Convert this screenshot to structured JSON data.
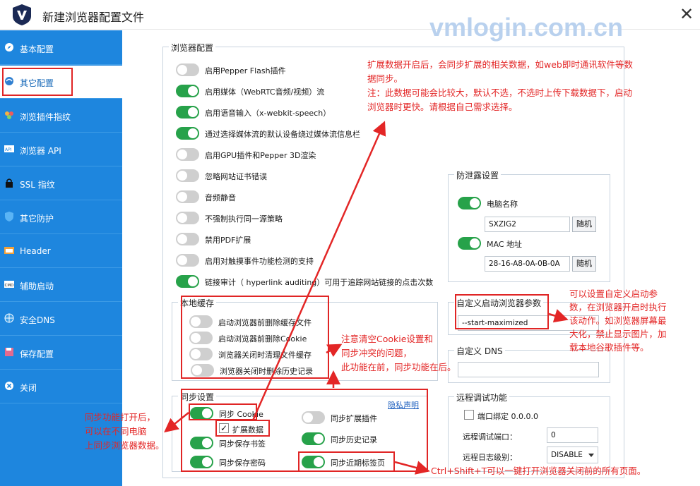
{
  "window": {
    "title": "新建浏览器配置文件",
    "close_label": "✕"
  },
  "watermark": "vmlogin.com.cn",
  "sidebar": {
    "items": [
      {
        "label": "基本配置",
        "icon": "compass-icon"
      },
      {
        "label": "其它配置",
        "icon": "browser-globe-icon",
        "active": true
      },
      {
        "label": "浏览插件指纹",
        "icon": "puzzle-icon"
      },
      {
        "label": "浏览器 API",
        "icon": "api-icon"
      },
      {
        "label": "SSL 指纹",
        "icon": "lock-icon"
      },
      {
        "label": "其它防护",
        "icon": "shield-icon"
      },
      {
        "label": "Header",
        "icon": "header-icon"
      },
      {
        "label": "辅助启动",
        "icon": "cmd-icon"
      },
      {
        "label": "安全DNS",
        "icon": "dns-globe-icon"
      },
      {
        "label": "保存配置",
        "icon": "floppy-icon"
      },
      {
        "label": "关闭",
        "icon": "close-circle-icon"
      }
    ]
  },
  "browser_config": {
    "title": "浏览器配置",
    "toggles": [
      {
        "label": "启用Pepper Flash插件",
        "on": false
      },
      {
        "label": "启用媒体（WebRTC音频/视频）流",
        "on": true
      },
      {
        "label": "启用语音输入（x-webkit-speech）",
        "on": true
      },
      {
        "label": "通过选择媒体流的默认设备绕过媒体流信息栏",
        "on": true
      },
      {
        "label": "启用GPU插件和Pepper 3D渲染",
        "on": false
      },
      {
        "label": "忽略网站证书错误",
        "on": false
      },
      {
        "label": "音频静音",
        "on": false
      },
      {
        "label": "不强制执行同一源策略",
        "on": false
      },
      {
        "label": "禁用PDF扩展",
        "on": false
      },
      {
        "label": "启用对触摸事件功能检测的支持",
        "on": false
      },
      {
        "label": "链接审计（ hyperlink auditing）可用于追踪网站链接的点击次数",
        "on": true
      }
    ]
  },
  "local_cache": {
    "title": "本地缓存",
    "toggles": [
      {
        "label": "启动浏览器前删除缓存文件",
        "on": false
      },
      {
        "label": "启动浏览器前删除Cookie",
        "on": false
      },
      {
        "label": "浏览器关闭时清理文件缓存",
        "on": false
      },
      {
        "label": "浏览器关闭时删除历史记录",
        "on": false
      }
    ]
  },
  "sync": {
    "title": "同步设置",
    "privacy_link": "隐私声明",
    "cookie": {
      "label": "同步 Cookie",
      "on": true
    },
    "extension_data": {
      "label": "扩展数据",
      "checked": true,
      "check_mark": "✓"
    },
    "bookmarks": {
      "label": "同步保存书签",
      "on": true
    },
    "passwords": {
      "label": "同步保存密码",
      "on": true
    },
    "extensions": {
      "label": "同步扩展插件",
      "on": false
    },
    "history": {
      "label": "同步历史记录",
      "on": true
    },
    "recent_tabs": {
      "label": "同步近期标签页",
      "on": true
    }
  },
  "anti_leak": {
    "title": "防泄露设置",
    "computer_name": {
      "label": "电脑名称",
      "on": true,
      "value": "SXZIG2",
      "random_label": "随机"
    },
    "mac": {
      "label": "MAC 地址",
      "on": true,
      "value": "28-16-A8-0A-0B-0A",
      "random_label": "随机"
    }
  },
  "custom_params": {
    "title": "自定义启动浏览器参数",
    "value": "--start-maximized"
  },
  "custom_dns": {
    "title": "自定义 DNS",
    "value": ""
  },
  "remote_debug": {
    "title": "远程调试功能",
    "port_bind_label": "端口绑定 0.0.0.0",
    "port_bind_checked": false,
    "port_label": "远程调试端口：",
    "port_value": "0",
    "log_level_label": "远程日志级别：",
    "log_level_value": "DISABLE"
  },
  "annotations": {
    "top": [
      "扩展数据开启后，会同步扩展的相关数据，如web即时通讯软件等数",
      "据同步。",
      "注：此数据可能会比较大，默认不选，不选时上传下载数据下，启动",
      "浏览器时更快。请根据自己需求选择。"
    ],
    "right": [
      "可以设置自定义启动参",
      "数，在浏览器开启时执行",
      "该动作。如浏览器屏幕最",
      "大化，禁止显示图片，加",
      "载本地谷歌插件等。"
    ],
    "middle": [
      "注意清空Cookie设置和",
      "同步冲突的问题，",
      "此功能在前，同步功能在后。"
    ],
    "left": [
      "同步功能打开后，",
      "可以在不同电脑",
      "上同步浏览器数据。"
    ],
    "bottom": "Ctrl+Shift+T可以一键打开浏览器关闭前的所有页面。"
  },
  "colors": {
    "accent": "#1e86de",
    "toggle_on": "#27a24a",
    "annotation_red": "#e32626"
  }
}
